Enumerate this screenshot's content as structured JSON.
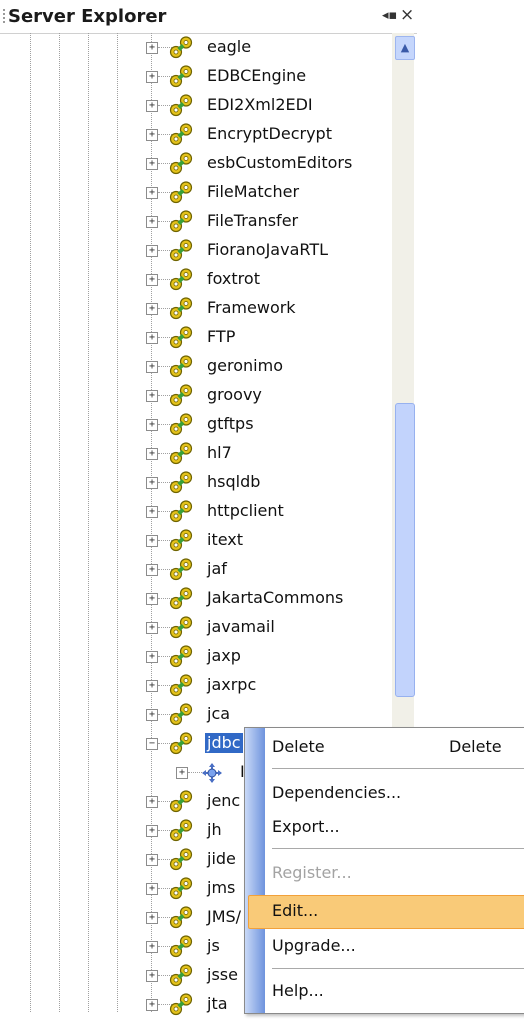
{
  "panel": {
    "title": "Server Explorer",
    "pin_icon": "pin-icon",
    "close_label": "×"
  },
  "tree": {
    "items": [
      {
        "label": "eagle"
      },
      {
        "label": "EDBCEngine"
      },
      {
        "label": "EDI2Xml2EDI"
      },
      {
        "label": "EncryptDecrypt"
      },
      {
        "label": "esbCustomEditors"
      },
      {
        "label": "FileMatcher"
      },
      {
        "label": "FileTransfer"
      },
      {
        "label": "FioranoJavaRTL"
      },
      {
        "label": "foxtrot"
      },
      {
        "label": "Framework"
      },
      {
        "label": "FTP"
      },
      {
        "label": "geronimo"
      },
      {
        "label": "groovy"
      },
      {
        "label": "gtftps"
      },
      {
        "label": "hl7"
      },
      {
        "label": "hsqldb"
      },
      {
        "label": "httpclient"
      },
      {
        "label": "itext"
      },
      {
        "label": "jaf"
      },
      {
        "label": "JakartaCommons"
      },
      {
        "label": "javamail"
      },
      {
        "label": "jaxp"
      },
      {
        "label": "jaxrpc"
      },
      {
        "label": "jca"
      },
      {
        "label": "jdbc",
        "selected": true,
        "expanded": true
      },
      {
        "label": "jenc"
      },
      {
        "label": "jh"
      },
      {
        "label": "jide"
      },
      {
        "label": "jms"
      },
      {
        "label": "JMS/"
      },
      {
        "label": "js"
      },
      {
        "label": "jsse"
      },
      {
        "label": "jta"
      }
    ],
    "jdbc_child": {
      "label": "I"
    }
  },
  "context_menu": {
    "items": [
      {
        "label": "Delete",
        "shortcut": "Delete"
      },
      {
        "label": "Dependencies..."
      },
      {
        "label": "Export..."
      },
      {
        "label": "Register...",
        "disabled": true
      },
      {
        "label": "Edit...",
        "highlighted": true
      },
      {
        "label": "Upgrade..."
      },
      {
        "label": "Help..."
      }
    ]
  },
  "colors": {
    "selection": "#3169c6",
    "menu_highlight": "#f9ca78",
    "scroll_thumb": "#c2d3fc"
  }
}
